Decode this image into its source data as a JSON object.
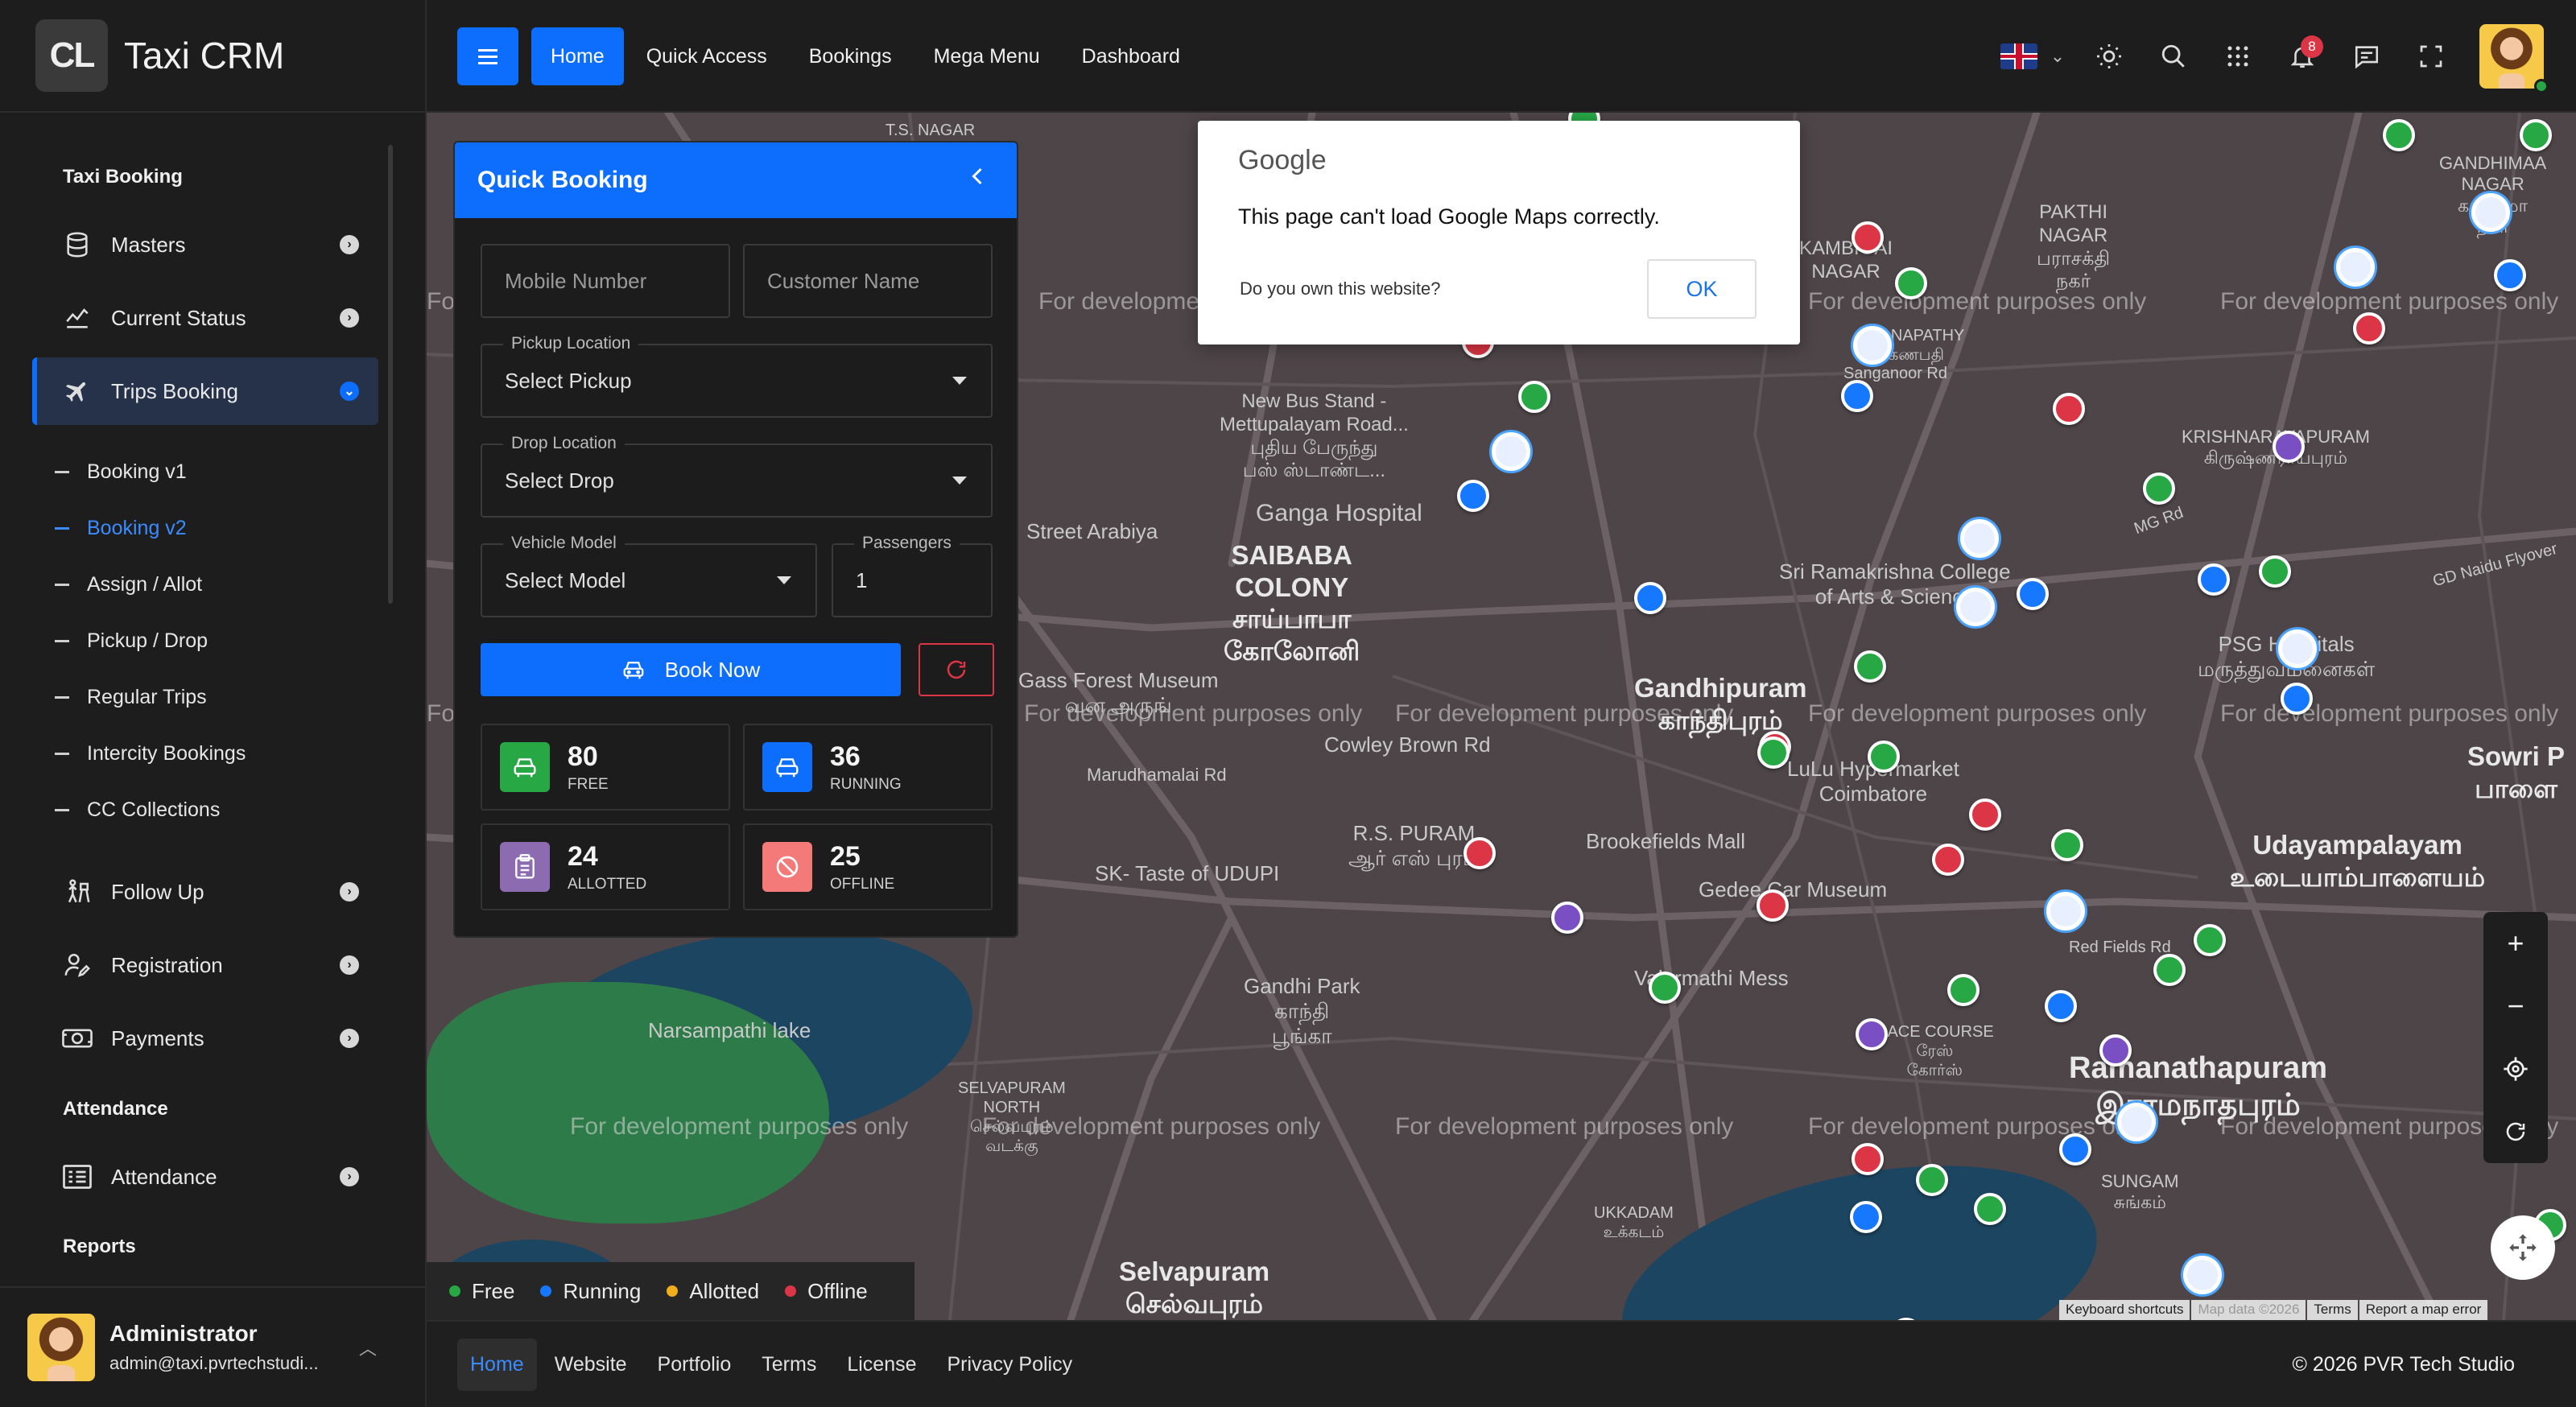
{
  "app": {
    "logo_text": "CL",
    "name": "Taxi CRM"
  },
  "sidebar": {
    "section_taxi": "Taxi Booking",
    "menu_top": [
      {
        "label": "Masters",
        "icon": "database-icon"
      },
      {
        "label": "Current Status",
        "icon": "chart-line-icon"
      },
      {
        "label": "Trips Booking",
        "icon": "airplane-icon",
        "active": true
      }
    ],
    "sub_items": [
      {
        "label": "Booking v1"
      },
      {
        "label": "Booking v2",
        "active": true
      },
      {
        "label": "Assign / Allot"
      },
      {
        "label": "Pickup / Drop"
      },
      {
        "label": "Regular Trips"
      },
      {
        "label": "Intercity Bookings"
      },
      {
        "label": "CC Collections"
      }
    ],
    "menu_bottom": [
      {
        "label": "Follow Up",
        "icon": "person-walking-icon"
      },
      {
        "label": "Registration",
        "icon": "user-edit-icon"
      },
      {
        "label": "Payments",
        "icon": "money-icon"
      }
    ],
    "section_attendance": "Attendance",
    "attendance_item": "Attendance",
    "section_reports": "Reports",
    "user": {
      "name": "Administrator",
      "email": "admin@taxi.pvrtechstudi..."
    }
  },
  "header": {
    "nav": [
      "Home",
      "Quick Access",
      "Bookings",
      "Mega Menu",
      "Dashboard"
    ],
    "active_nav": "Home",
    "notification_count": "8"
  },
  "map": {
    "watermark": "For development purposes only",
    "places": [
      {
        "text": "GANDHIMAA\nNAGAR\nகாந்திமா\nநகர்"
      },
      {
        "text": "KRISHNARAYAPURAM\nகிருஷ்ணராயபுரம்"
      },
      {
        "text": "New Bus Stand -\nMettupalayam Road...\nபுதிய பேருந்து\nபஸ் ஸ்டாண்ட..."
      },
      {
        "text": "Ganga Hospital"
      },
      {
        "text": "SAIBABA\nCOLONY\nசாய்பாபா\nகோலோனி",
        "big": true
      },
      {
        "text": "Street Arabiya"
      },
      {
        "text": "Sri Ramakrishna College\nof Arts & Science"
      },
      {
        "text": "Gandhipuram\nகாந்திபுரம்",
        "big": true
      },
      {
        "text": "PSG Hospitals\nமருத்துவமனைகள்"
      },
      {
        "text": "Gass Forest Museum\nவன அருங்"
      },
      {
        "text": "Cowley Brown Rd"
      },
      {
        "text": "LuLu Hypermarket\nCoimbatore"
      },
      {
        "text": "Udayampalayam\nஉடையாம்பாளையம்",
        "big": true
      },
      {
        "text": "Sowri P\nபாளை",
        "big": true
      },
      {
        "text": "R.S. PURAM\nஆர் எஸ் புரம்"
      },
      {
        "text": "Brookefields Mall"
      },
      {
        "text": "Gedee Car Museum"
      },
      {
        "text": "SK- Taste of UDUPI"
      },
      {
        "text": "Marudhamalai Rd"
      },
      {
        "text": "Gandhi Park\nகாந்தி\nபூங்கா"
      },
      {
        "text": "Valarmathi Mess"
      },
      {
        "text": "Narsampathi lake"
      },
      {
        "text": "Ramanathapuram\nஇராமநாதபுரம்",
        "big": true
      },
      {
        "text": "RACE COURSE\nரேஸ்\nகோர்ஸ்"
      },
      {
        "text": "SELVAPURAM\nNORTH\nசெல்வபுரம்\nவடக்கு"
      },
      {
        "text": "Selvapuram\nசெல்வபுரம்",
        "big": true
      },
      {
        "text": "UKKADAM\nஉக்கடம்"
      },
      {
        "text": "SUNGAM\nசுங்கம்"
      },
      {
        "text": "Red Fields Rd"
      },
      {
        "text": "T.S. NAGAR"
      },
      {
        "text": "KAMBIGAI\nNAGAR"
      },
      {
        "text": "PAKTHI\nNAGAR\nபராசக்தி\nநகர்"
      },
      {
        "text": "GANAPATHY\nகணபதி"
      },
      {
        "text": "Sanganoor Rd"
      },
      {
        "text": "MG Rd"
      },
      {
        "text": "GD Naidu Flyover"
      }
    ]
  },
  "google_dialog": {
    "logo": "Google",
    "message": "This page can't load Google Maps correctly.",
    "question": "Do you own this website?",
    "ok": "OK"
  },
  "quick_booking": {
    "title": "Quick Booking",
    "mobile_placeholder": "Mobile Number",
    "name_placeholder": "Customer Name",
    "pickup_label": "Pickup Location",
    "pickup_value": "Select Pickup",
    "drop_label": "Drop Location",
    "drop_value": "Select Drop",
    "vehicle_label": "Vehicle Model",
    "vehicle_value": "Select Model",
    "passengers_label": "Passengers",
    "passengers_value": "1",
    "book_label": "Book Now",
    "stats": [
      {
        "value": "80",
        "label": "FREE",
        "color": "#28a745"
      },
      {
        "value": "36",
        "label": "RUNNING",
        "color": "#0d6efd"
      },
      {
        "value": "24",
        "label": "ALLOTTED",
        "color": "#8c6bb1"
      },
      {
        "value": "25",
        "label": "OFFLINE",
        "color": "#f47a7a"
      }
    ]
  },
  "legend": [
    {
      "label": "Free",
      "color": "#28a745"
    },
    {
      "label": "Running",
      "color": "#1677ff"
    },
    {
      "label": "Allotted",
      "color": "#f0ad1c"
    },
    {
      "label": "Offline",
      "color": "#dc3545"
    }
  ],
  "map_attribution": [
    "Keyboard shortcuts",
    "Map data ©2026",
    "Terms",
    "Report a map error"
  ],
  "footer": {
    "links": [
      "Home",
      "Website",
      "Portfolio",
      "Terms",
      "License",
      "Privacy Policy"
    ],
    "copyright": "© 2026  PVR Tech Studio"
  },
  "colors": {
    "accent": "#0d6efd",
    "marker_free": "#28a745",
    "marker_running": "#1677ff",
    "marker_allotted": "#7b4fc4",
    "marker_offline": "#dc3545"
  }
}
